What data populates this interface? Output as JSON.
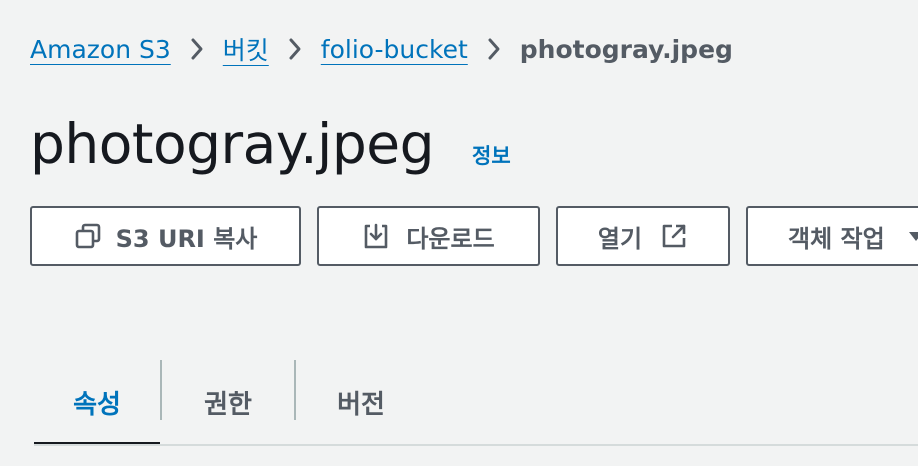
{
  "breadcrumb": {
    "items": [
      {
        "label": "Amazon S3"
      },
      {
        "label": "버킷"
      },
      {
        "label": "folio-bucket"
      }
    ],
    "current": "photogray.jpeg",
    "separator_icon": "chevron-right-icon"
  },
  "header": {
    "title": "photogray.jpeg",
    "info_label": "정보"
  },
  "toolbar": {
    "copy_uri": {
      "label": "S3 URI 복사",
      "icon": "copy-icon"
    },
    "download": {
      "label": "다운로드",
      "icon": "download-icon"
    },
    "open": {
      "label": "열기",
      "icon": "external-link-icon"
    },
    "object_actions": {
      "label": "객체 작업",
      "icon": "caret-down-icon"
    }
  },
  "tabs": [
    {
      "label": "속성",
      "active": true
    },
    {
      "label": "권한",
      "active": false
    },
    {
      "label": "버전",
      "active": false
    }
  ],
  "colors": {
    "background": "#f2f3f3",
    "link": "#0073bb",
    "text_primary": "#16191f",
    "text_secondary": "#545b64",
    "button_border": "#545b64",
    "tab_divider": "#aab7b8",
    "tab_baseline": "#d5dbdb"
  }
}
